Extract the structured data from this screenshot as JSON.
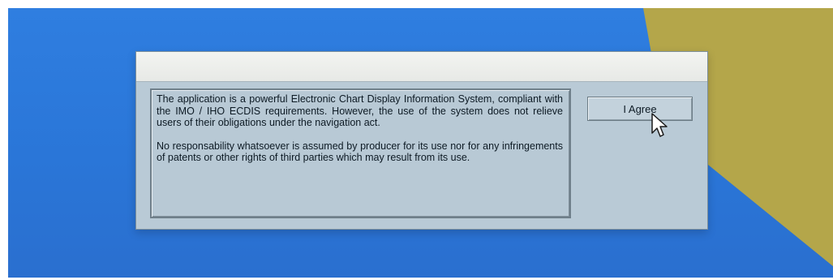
{
  "dialog": {
    "paragraphs": [
      "The application is a powerful Electronic Chart Display Information System, compliant with the IMO / IHO ECDIS requirements. However, the use of the system does not relieve users of their obligations under the navigation act.",
      "No responsability whatsoever is assumed by producer for its use nor for any infringements of patents or other rights of third parties which may result from its use."
    ],
    "agree_label": "I Agree"
  },
  "colors": {
    "desktop_blue": "#2f7ee0",
    "desktop_olive": "#b4a64a",
    "dialog_body": "#b9cad6"
  }
}
